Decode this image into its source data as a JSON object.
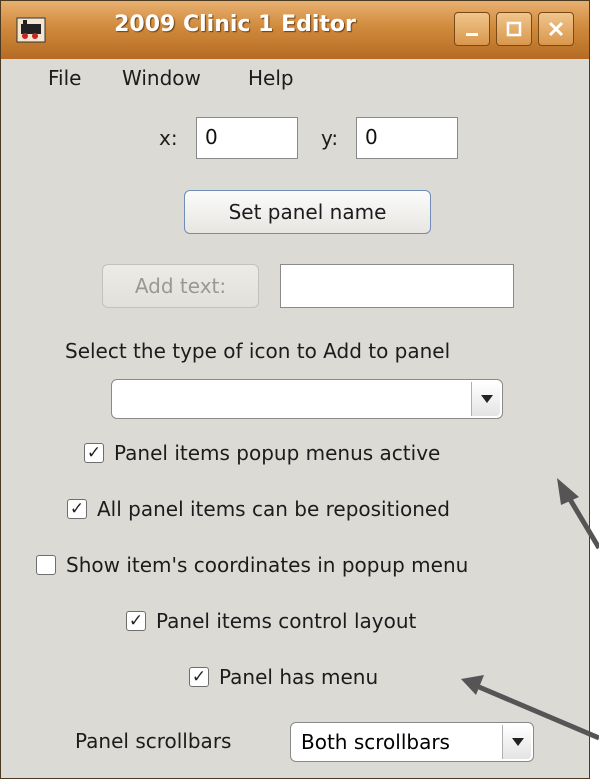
{
  "window": {
    "title": "2009 Clinic 1 Editor"
  },
  "menubar": {
    "items": [
      "File",
      "Window",
      "Help"
    ]
  },
  "coords": {
    "x_label": "x:",
    "x_value": "0",
    "y_label": "y:",
    "y_value": "0"
  },
  "buttons": {
    "set_panel_name": "Set panel name",
    "add_text": "Add text:"
  },
  "add_text_field": {
    "value": ""
  },
  "icon_type": {
    "label": "Select the type of icon to Add to panel",
    "selected": ""
  },
  "checkboxes": [
    {
      "label": "Panel items popup menus active",
      "checked": true,
      "mark": "✓"
    },
    {
      "label": "All panel items can be repositioned",
      "checked": true,
      "mark": "✓"
    },
    {
      "label": "Show item's coordinates in popup menu",
      "checked": false,
      "mark": ""
    },
    {
      "label": "Panel items control layout",
      "checked": true,
      "mark": "✓"
    },
    {
      "label": "Panel has menu",
      "checked": true,
      "mark": "✓"
    }
  ],
  "scrollbars": {
    "label": "Panel scrollbars",
    "selected": "Both scrollbars"
  }
}
